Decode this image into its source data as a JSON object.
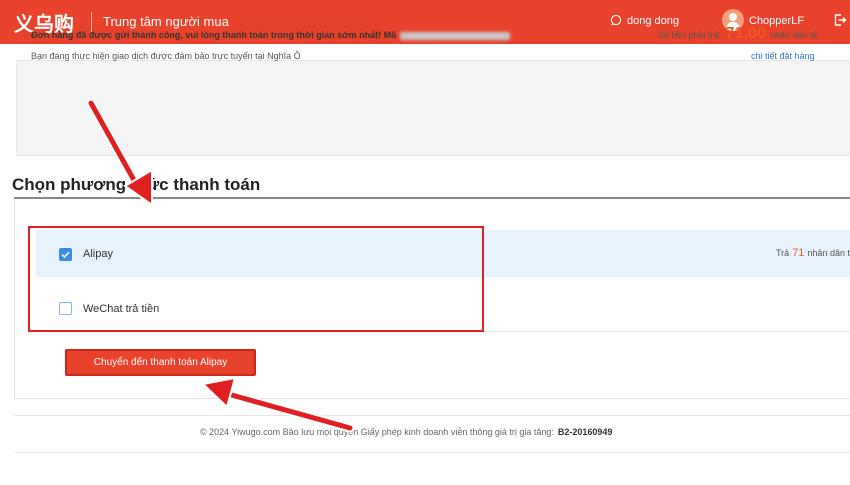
{
  "header": {
    "logo": "义乌购",
    "title": "Trung tâm người mua",
    "chat_label": "dong dong",
    "user_label": "ChopperLF",
    "bg_color": "#e8412c"
  },
  "notice": {
    "message": "Đơn hàng đã được gửi thành công, vui lòng thanh toán trong thời gian sớm nhất! Mã",
    "subtext": "Bạn đang thực hiện giao dịch được đảm bảo trực tuyến tại Nghĩa Ô",
    "amount_label": "Số tiền phải trả:",
    "amount_value": "71,00",
    "amount_unit": "nhân dân tệ",
    "order_detail_link": "chi tiết đặt hàng"
  },
  "payment": {
    "section_title": "Chọn phương thức thanh toán",
    "options": [
      {
        "label": "Alipay",
        "checked": true
      },
      {
        "label": "WeChat trả tiền",
        "checked": false
      }
    ],
    "pay_prefix": "Trả",
    "pay_amount": "71",
    "pay_unit": "nhân dân tệ",
    "submit_label": "Chuyển đến thanh toán Alipay",
    "accent_color": "#3a8ee6"
  },
  "footer": {
    "copyright": "© 2024 Yiwugo.com Bảo lưu mọi quyền Giấy phép kinh doanh viễn thông giá trị gia tăng:",
    "license": "B2-20160949"
  },
  "annotations": {
    "highlight_color": "#e02020"
  }
}
